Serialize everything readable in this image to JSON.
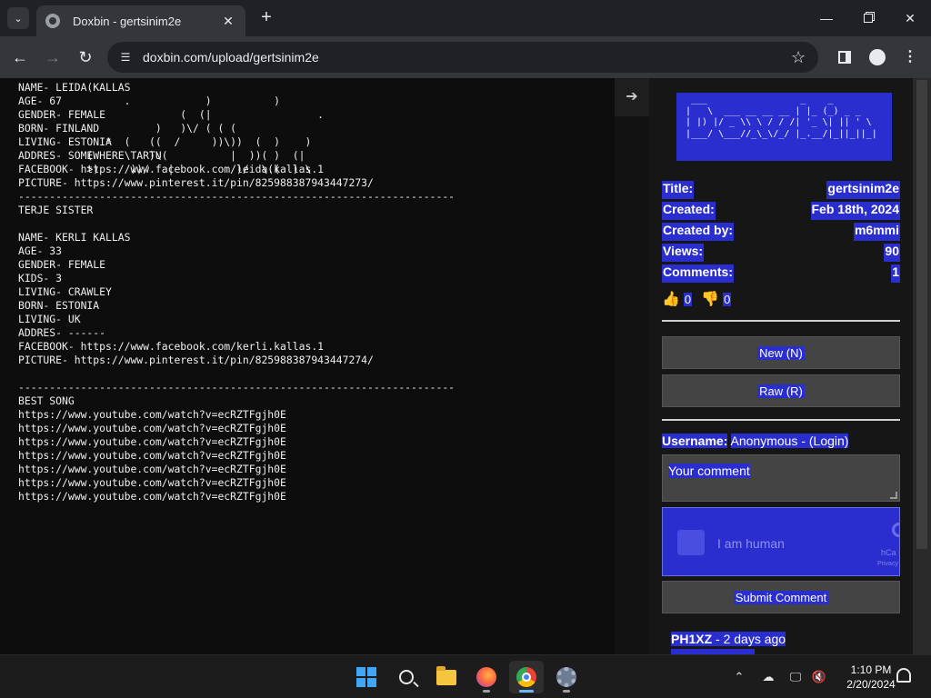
{
  "browser": {
    "tab_title": "Doxbin - gertsinim2e",
    "url": "doxbin.com/upload/gertsinim2e"
  },
  "paste": {
    "lines": [
      "NAME- LEIDA KALLAS",
      "AGE- 67",
      "GENDER- FEMALE",
      "BORN- FINLAND",
      "LIVING- ESTONIA",
      "ADDRES- SOMEWHERE TARTU",
      "FACEBOOK- https://www.facebook.com/leida.kallas.1",
      "PICTURE- https://www.pinterest.it/pin/825988387943447273/",
      "----------------------------------------------------------------------",
      "TERJE SISTER",
      "",
      "NAME- KERLI KALLAS",
      "AGE- 33",
      "GENDER- FEMALE",
      "KIDS- 3",
      "LIVING- CRAWLEY",
      "BORN- ESTONIA",
      "LIVING- UK",
      "ADDRES- ------",
      "FACEBOOK- https://www.facebook.com/kerli.kallas.1",
      "PICTURE- https://www.pinterest.it/pin/825988387943447274/",
      "",
      "----------------------------------------------------------------------",
      "BEST SONG",
      "https://www.youtube.com/watch?v=ecRZTFgjh0E",
      "https://www.youtube.com/watch?v=ecRZTFgjh0E",
      "https://www.youtube.com/watch?v=ecRZTFgjh0E",
      "https://www.youtube.com/watch?v=ecRZTFgjh0E",
      "https://www.youtube.com/watch?v=ecRZTFgjh0E",
      "https://www.youtube.com/watch?v=ecRZTFgjh0E",
      "https://www.youtube.com/watch?v=ecRZTFgjh0E"
    ],
    "ascii_art": "           (\n                 .            )          )\n                          (  (|                 .\n                      )   )\\/ ( ( (\n              *  (   ((  /     ))\\))  (  )    )\n           (     \\   )\\(          |  ))( )  (|\n           >)     ))/   |          )/  \\((  ) \\"
  },
  "sidebar": {
    "logo_art": " ___                 _    _\n|   \\  ___ __ __ __ | |_ (_) _ _\n| |) |/ _ \\\\ \\ / / /| '_ \\| || ' \\\n|___/ \\___//_\\_\\/_/ |_.__/|_||_||_|",
    "meta": [
      {
        "label": "Title:",
        "value": "gertsinim2e"
      },
      {
        "label": "Created:",
        "value": "Feb 18th, 2024"
      },
      {
        "label": "Created by:",
        "value": "m6mmi"
      },
      {
        "label": "Views:",
        "value": "90"
      },
      {
        "label": "Comments:",
        "value": "1"
      }
    ],
    "likes": "0",
    "dislikes": "0",
    "new_button": "New (N)",
    "raw_button": "Raw (R)",
    "username_label": "Username:",
    "username_value": "Anonymous - (Login)",
    "comment_placeholder": "Your comment",
    "captcha_label": "I am human",
    "captcha_brand": "hCa",
    "captcha_privacy": "Privacy",
    "submit_button": "Submit Comment",
    "comment_author": "PH1XZ",
    "comment_time": " - 2 days ago"
  },
  "taskbar": {
    "time": "1:10 PM",
    "date": "2/20/2024"
  },
  "colors": {
    "highlight": "#2a2ecf",
    "background": "#0d0d0d"
  }
}
